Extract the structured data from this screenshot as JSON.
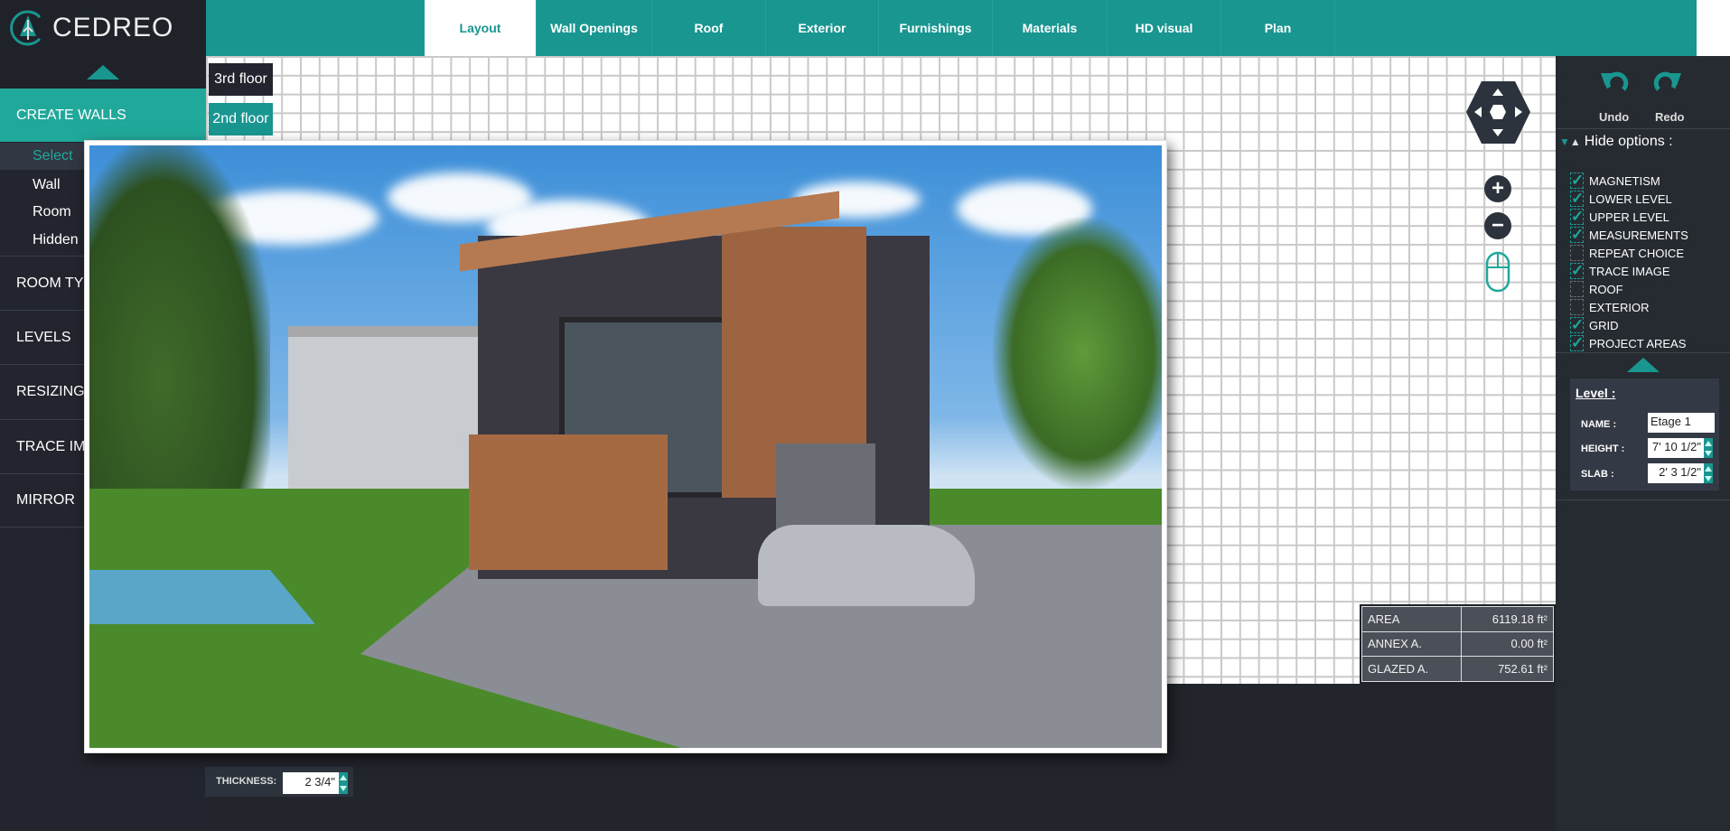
{
  "brand": {
    "name": "CEDREO"
  },
  "tabs": [
    {
      "label": "Layout",
      "active": true
    },
    {
      "label": "Wall Openings"
    },
    {
      "label": "Roof"
    },
    {
      "label": "Exterior"
    },
    {
      "label": "Furnishings"
    },
    {
      "label": "Materials"
    },
    {
      "label": "HD visual"
    },
    {
      "label": "Plan"
    }
  ],
  "sidebar": {
    "active_section": "CREATE WALLS",
    "sub_items": [
      "Select",
      "Wall",
      "Room",
      "Hidden"
    ],
    "sections": [
      "ROOM TY",
      "LEVELS",
      "RESIZING",
      "TRACE IM",
      "MIRROR"
    ]
  },
  "floors": [
    "3rd floor",
    "2nd floor"
  ],
  "toolbar": {
    "undo": "Undo",
    "redo": "Redo"
  },
  "options": {
    "title": "Hide options :",
    "items": [
      {
        "label": "MAGNETISM",
        "checked": true
      },
      {
        "label": "LOWER LEVEL",
        "checked": true
      },
      {
        "label": "UPPER LEVEL",
        "checked": true
      },
      {
        "label": "MEASUREMENTS",
        "checked": true
      },
      {
        "label": "REPEAT CHOICE",
        "checked": false
      },
      {
        "label": "TRACE IMAGE",
        "checked": true
      },
      {
        "label": "ROOF",
        "checked": false
      },
      {
        "label": "EXTERIOR",
        "checked": false
      },
      {
        "label": "GRID",
        "checked": true
      },
      {
        "label": "PROJECT AREAS",
        "checked": true
      }
    ]
  },
  "level": {
    "title": "Level :",
    "name_label": "NAME :",
    "name": "Etage 1",
    "height_label": "HEIGHT :",
    "height": "7' 10 1/2\"",
    "slab_label": "SLAB :",
    "slab": "2' 3 1/2\""
  },
  "stats": [
    {
      "label": "AREA",
      "value": "6119.18 ft²"
    },
    {
      "label": "ANNEX A.",
      "value": "0.00 ft²"
    },
    {
      "label": "GLAZED A.",
      "value": "752.61 ft²"
    }
  ],
  "thickness": {
    "label": "THICKNESS:",
    "value": "2 3/4\""
  },
  "colors": {
    "teal": "#1a9690",
    "accent": "#20a89a",
    "dark": "#22252d"
  }
}
